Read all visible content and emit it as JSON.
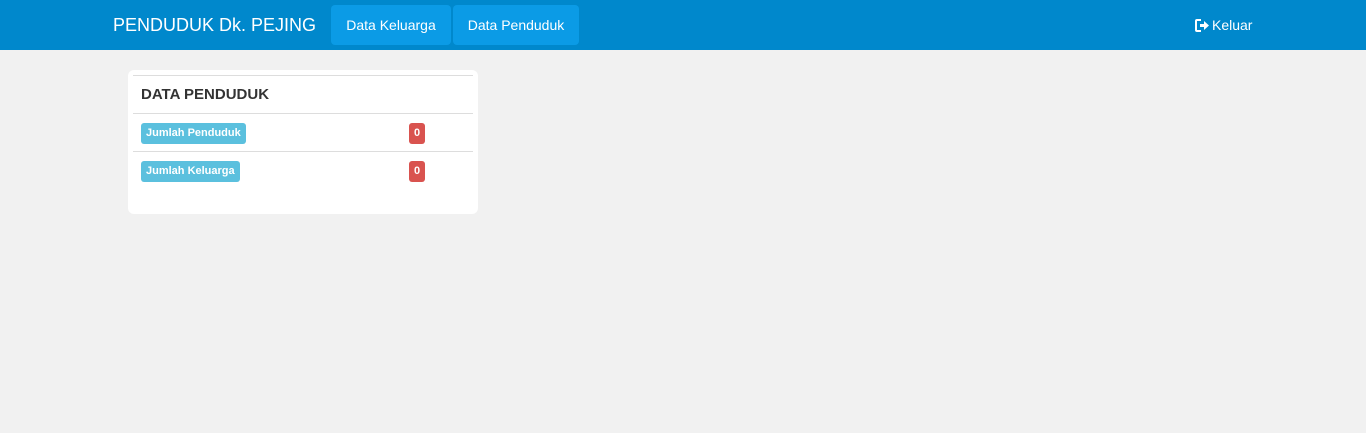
{
  "navbar": {
    "brand": "PENDUDUK Dk. PEJING",
    "items": [
      {
        "label": "Data Keluarga"
      },
      {
        "label": "Data Penduduk"
      }
    ],
    "logout_label": "Keluar",
    "logout_icon": "sign-out-icon",
    "color": "#0088cc"
  },
  "panel": {
    "title": "DATA PENDUDUK",
    "rows": [
      {
        "label": "Jumlah Penduduk",
        "count": "0"
      },
      {
        "label": "Jumlah Keluarga",
        "count": "0"
      }
    ]
  }
}
